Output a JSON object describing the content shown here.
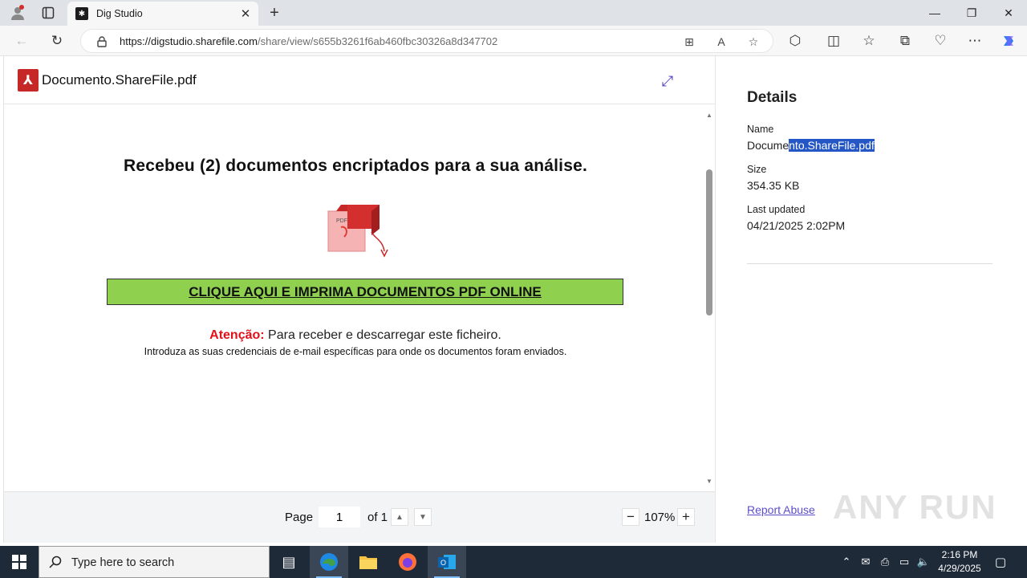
{
  "browser": {
    "tab_title": "Dig Studio",
    "url_host": "https://digstudio.sharefile.com",
    "url_path": "/share/view/s655b3261f6ab460fbc30326a8d347702"
  },
  "viewer": {
    "file_title": "Documento.ShareFile.pdf",
    "headline": "Recebeu (2) documentos encriptados para a sua análise.",
    "cta_label": "CLIQUE AQUI E IMPRIMA DOCUMENTOS PDF ONLINE",
    "attention_label": "Atenção:",
    "attention_text": " Para receber e descarregar este ficheiro.",
    "instruction": "Introduza as suas credenciais de e-mail específicas para onde os documentos foram enviados.",
    "doc_icon_text": "PDF"
  },
  "pager": {
    "page_label": "Page",
    "page_value": "1",
    "of_label": "of 1",
    "zoom": "107%"
  },
  "details": {
    "title": "Details",
    "name_label": "Name",
    "name_value_a": "Docume",
    "name_value_b": "nto.ShareFile.pdf",
    "size_label": "Size",
    "size_value": "354.35 KB",
    "updated_label": "Last updated",
    "updated_value": "04/21/2025 2:02PM",
    "report": "Report Abuse",
    "watermark": "ANY RUN"
  },
  "taskbar": {
    "search_placeholder": "Type here to search",
    "time": "2:16 PM",
    "date": "4/29/2025"
  },
  "colors": {
    "cta_bg": "#8fd14f",
    "attention_red": "#e3101a",
    "link_purple": "#5b4ec6",
    "selection_blue": "#2457c5",
    "pdf_red": "#c62828"
  }
}
